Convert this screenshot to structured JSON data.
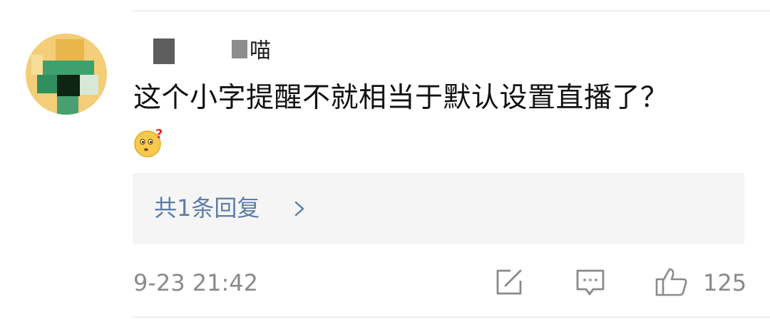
{
  "comment": {
    "username_suffix": "喵",
    "text": "这个小字提醒不就相当于默认设置直播了？",
    "emoji_icon": "confused-face-with-question-mark-icon"
  },
  "replies": {
    "label": "共1条回复",
    "chevron_icon": "chevron-right-icon"
  },
  "footer": {
    "timestamp": "9-23 21:42",
    "like_count": "125",
    "share_icon": "share-icon",
    "reply_icon": "comment-icon",
    "like_icon": "thumbs-up-icon"
  },
  "colors": {
    "link": "#5b7ea7",
    "avatar_bg": "#f3cd78",
    "muted_text": "#8a8a8a"
  }
}
